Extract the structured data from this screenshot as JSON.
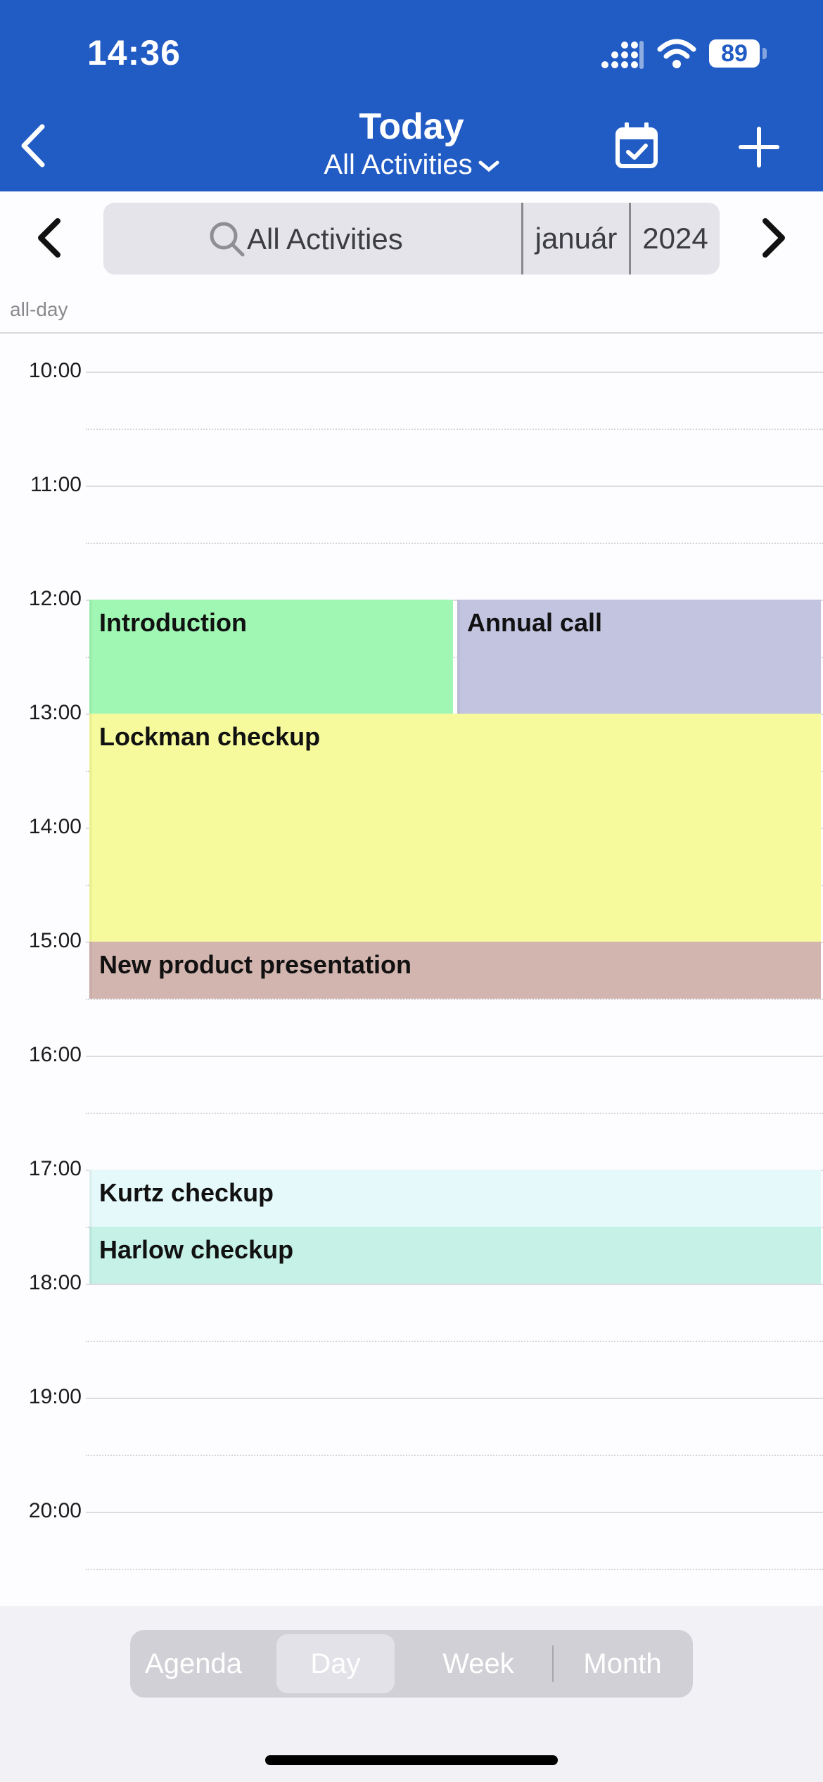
{
  "status_bar": {
    "time": "14:36",
    "battery": "89"
  },
  "header": {
    "title": "Today",
    "subtitle": "All Activities"
  },
  "filter": {
    "search_label": "All Activities",
    "month": "január",
    "year": "2024"
  },
  "allday_label": "all-day",
  "hours": [
    "10:00",
    "11:00",
    "12:00",
    "13:00",
    "14:00",
    "15:00",
    "16:00",
    "17:00",
    "18:00",
    "19:00",
    "20:00"
  ],
  "events": [
    {
      "title": "Introduction",
      "start": "12:00",
      "end": "13:00",
      "color": "#a0f7b4"
    },
    {
      "title": "Annual call",
      "start": "12:00",
      "end": "13:00",
      "color": "#c2c4e0"
    },
    {
      "title": "Lockman checkup",
      "start": "13:00",
      "end": "15:00",
      "color": "#f6fa9c"
    },
    {
      "title": "New product presentation",
      "start": "15:00",
      "end": "15:30",
      "color": "#d3b5b0"
    },
    {
      "title": "Kurtz checkup",
      "start": "17:00",
      "end": "17:30",
      "color": "#e5f9fb"
    },
    {
      "title": "Harlow checkup",
      "start": "17:30",
      "end": "18:00",
      "color": "#c5f1e6"
    }
  ],
  "view_tabs": [
    "Agenda",
    "Day",
    "Week",
    "Month"
  ],
  "active_view": "Day",
  "colors": {
    "header": "#215bc4",
    "background": "#fdfcfe"
  }
}
